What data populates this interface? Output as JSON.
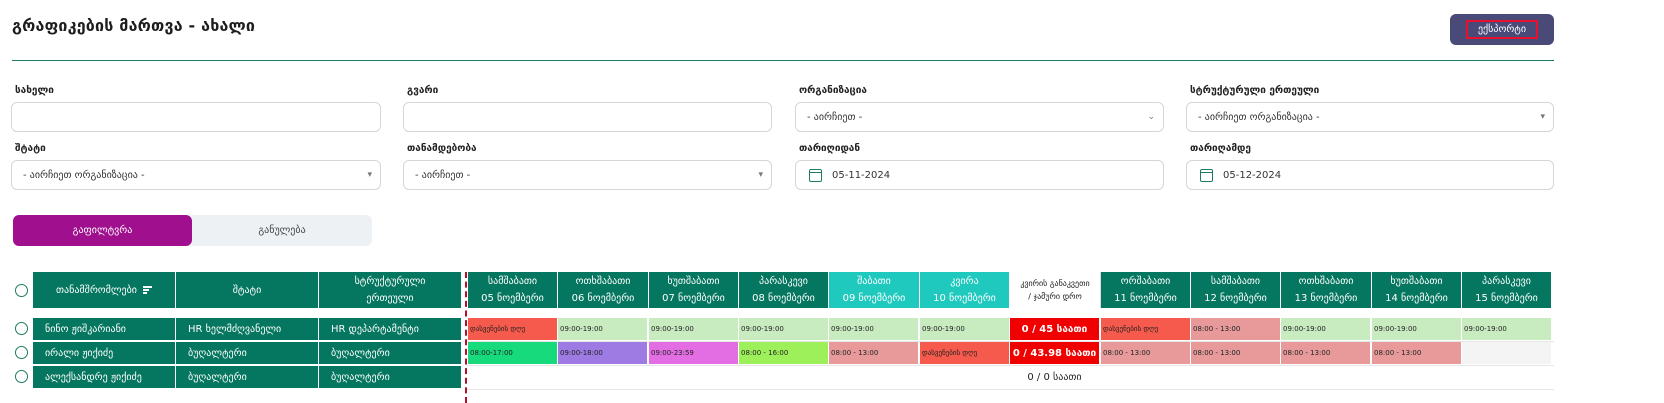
{
  "header": {
    "title": "გრაფიკების მართვა - ახალი",
    "export_label": "ექსპორტი"
  },
  "filters": {
    "name": {
      "label": "სახელი",
      "value": ""
    },
    "surname": {
      "label": "გვარი",
      "value": ""
    },
    "organization": {
      "label": "ორგანიზაცია",
      "value": "- აირჩიეთ -"
    },
    "unit": {
      "label": "სტრუქტურული ერთეული",
      "value": "- აირჩიეთ ორგანიზაცია -"
    },
    "staff": {
      "label": "შტატი",
      "value": "- აირჩიეთ ორგანიზაცია -"
    },
    "position": {
      "label": "თანამდებობა",
      "value": "- აირჩიეთ -"
    },
    "date_from": {
      "label": "თარიღიდან",
      "value": "05-11-2024"
    },
    "date_to": {
      "label": "თარიღამდე",
      "value": "05-12-2024"
    }
  },
  "tabs": {
    "filter": "გაფილტვრა",
    "reset": "განულება"
  },
  "table": {
    "fixed_headers": [
      "თანამშრომლები",
      "შტატი",
      "სტრუქტურული ერთეული"
    ],
    "days": [
      {
        "day": "სამშაბათი",
        "date": "05 ნოემბერი",
        "type": "day"
      },
      {
        "day": "ოთხშაბათი",
        "date": "06 ნოემბერი",
        "type": "day"
      },
      {
        "day": "ხუთშაბათი",
        "date": "07 ნოემბერი",
        "type": "day"
      },
      {
        "day": "პარასკევი",
        "date": "08 ნოემბერი",
        "type": "day"
      },
      {
        "day": "შაბათი",
        "date": "09 ნოემბერი",
        "type": "weekend"
      },
      {
        "day": "კვირა",
        "date": "10 ნოემბერი",
        "type": "weekend"
      },
      {
        "day": "კვირის განაკვეთი",
        "date": "/ ჯამური დრო",
        "type": "summary"
      },
      {
        "day": "ორშაბათი",
        "date": "11 ნოემბერი",
        "type": "day"
      },
      {
        "day": "სამშაბათი",
        "date": "12 ნოემბერი",
        "type": "day"
      },
      {
        "day": "ოთხშაბათი",
        "date": "13 ნოემბერი",
        "type": "day"
      },
      {
        "day": "ხუთშაბათი",
        "date": "14 ნოემბერი",
        "type": "day"
      },
      {
        "day": "პარასკევი",
        "date": "15 ნოემბერი",
        "type": "day"
      }
    ],
    "rows": [
      {
        "name": "ნინო ჟიშკარიანი",
        "staff": "HR ხელმძღვანელი",
        "unit": "HR დეპარტამენტი",
        "cells": [
          {
            "text": "დასვენების დღე",
            "color": "#f55a4c"
          },
          {
            "text": "09:00-19:00",
            "color": "#c8ebc0"
          },
          {
            "text": "09:00-19:00",
            "color": "#c8ebc0"
          },
          {
            "text": "09:00-19:00",
            "color": "#c8ebc0"
          },
          {
            "text": "09:00-19:00",
            "color": "#c8ebc0"
          },
          {
            "text": "09:00-19:00",
            "color": "#c8ebc0"
          },
          {
            "text": "0 / 45 საათი",
            "color": "#f00000"
          },
          {
            "text": "დასვენების დღე",
            "color": "#f55a4c"
          },
          {
            "text": "08:00 - 13:00",
            "color": "#e89a9a"
          },
          {
            "text": "09:00-19:00",
            "color": "#c8ebc0"
          },
          {
            "text": "09:00-19:00",
            "color": "#c8ebc0"
          },
          {
            "text": "09:00-19:00",
            "color": "#c8ebc0"
          }
        ]
      },
      {
        "name": "ირალი ჟიქიძე",
        "staff": "ბუღალტერი",
        "unit": "ბუღალტერი",
        "cells": [
          {
            "text": "08:00-17:00",
            "color": "#16da7c"
          },
          {
            "text": "09:00-18:00",
            "color": "#9d7be3"
          },
          {
            "text": "09:00-23:59",
            "color": "#e36de3"
          },
          {
            "text": "08:00 - 16:00",
            "color": "#9ef05a"
          },
          {
            "text": "08:00 - 13:00",
            "color": "#e89a9a"
          },
          {
            "text": "დასვენების დღე",
            "color": "#f55a4c"
          },
          {
            "text": "0 / 43.98 საათი",
            "color": "#f00000"
          },
          {
            "text": "08:00 - 13:00",
            "color": "#e89a9a"
          },
          {
            "text": "08:00 - 13:00",
            "color": "#e89a9a"
          },
          {
            "text": "08:00 - 13:00",
            "color": "#e89a9a"
          },
          {
            "text": "08:00 - 13:00",
            "color": "#e89a9a"
          },
          {
            "text": "",
            "color": "#f4f4f4"
          }
        ]
      },
      {
        "name": "ალექსანდრე ჟიქიძე",
        "staff": "ბუღალტერი",
        "unit": "ბუღალტერი",
        "cells": [
          {
            "text": "",
            "color": "#ffffff"
          },
          {
            "text": "",
            "color": "#ffffff"
          },
          {
            "text": "",
            "color": "#ffffff"
          },
          {
            "text": "",
            "color": "#ffffff"
          },
          {
            "text": "",
            "color": "#ffffff"
          },
          {
            "text": "",
            "color": "#ffffff"
          },
          {
            "text": "0 / 0 საათი",
            "color": "plain"
          },
          {
            "text": "",
            "color": "#ffffff"
          },
          {
            "text": "",
            "color": "#ffffff"
          },
          {
            "text": "",
            "color": "#ffffff"
          },
          {
            "text": "",
            "color": "#ffffff"
          },
          {
            "text": "",
            "color": "#ffffff"
          }
        ]
      }
    ]
  }
}
